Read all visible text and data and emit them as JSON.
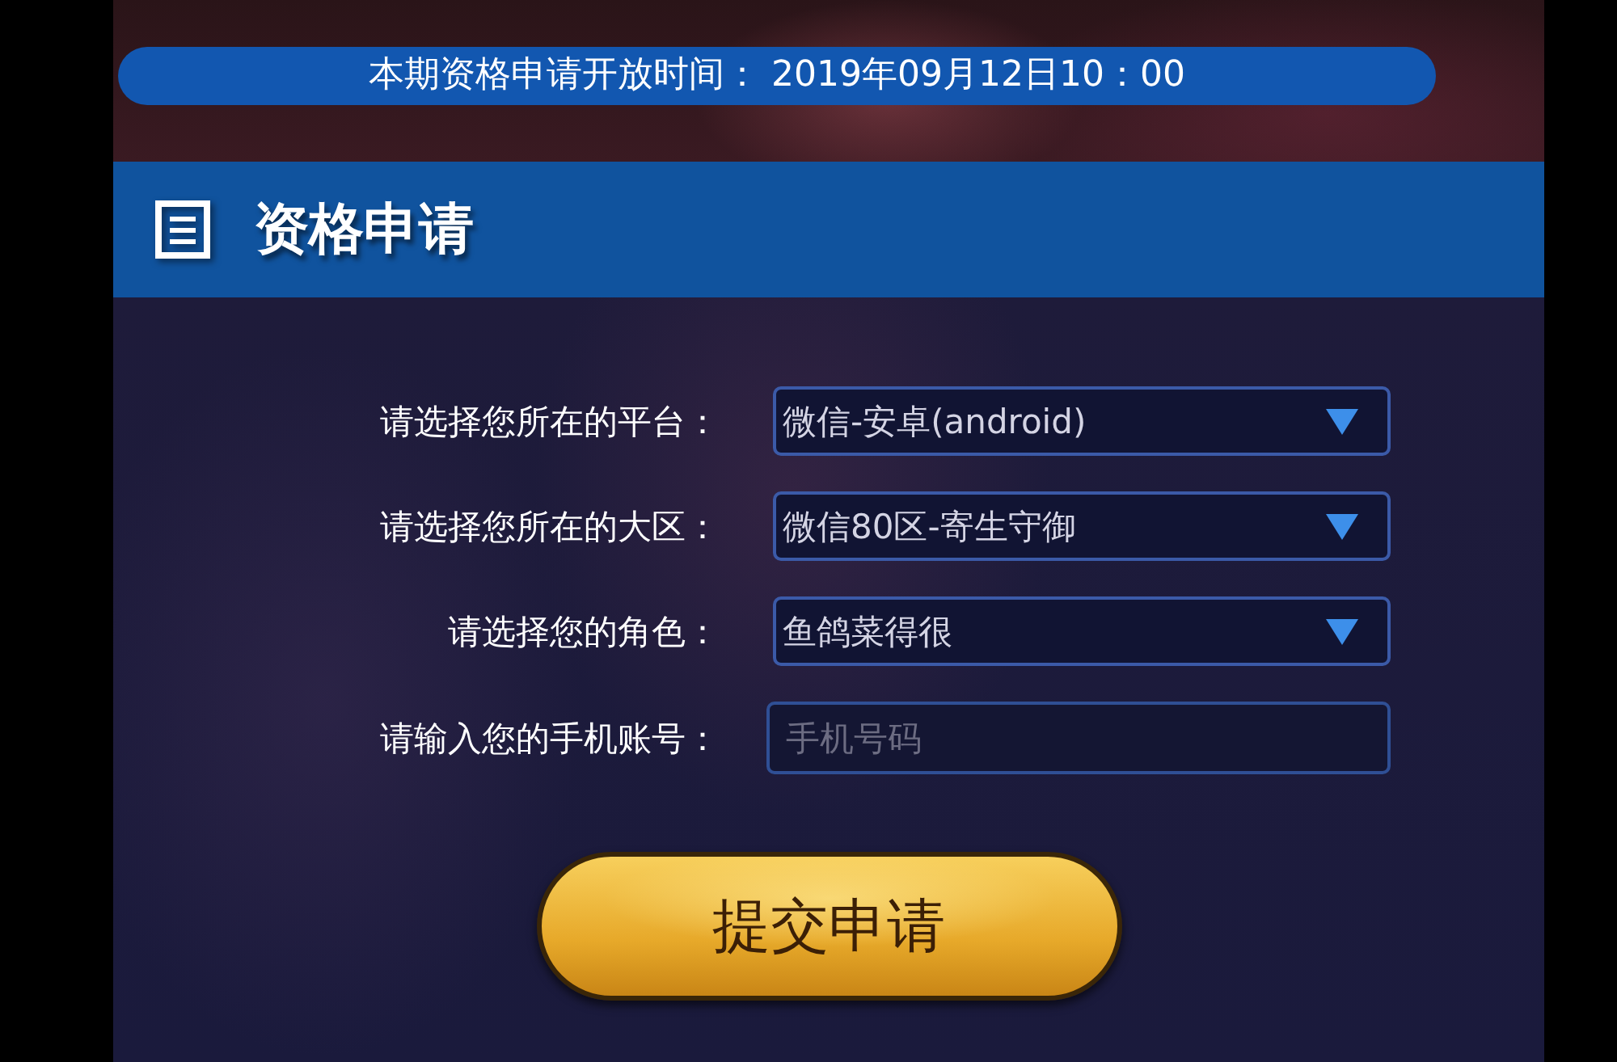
{
  "banner": {
    "text": "本期资格申请开放时间： 2019年09月12日10：00"
  },
  "section": {
    "title": "资格申请"
  },
  "form": {
    "fields": [
      {
        "kind": "select",
        "label": "请选择您所在的平台：",
        "value": "微信-安卓(android)"
      },
      {
        "kind": "select",
        "label": "请选择您所在的大区：",
        "value": "微信80区-寄生守御"
      },
      {
        "kind": "select",
        "label": "请选择您的角色：",
        "value": "鱼鸽菜得很"
      },
      {
        "kind": "input",
        "label": "请输入您的手机账号：",
        "placeholder": "手机号码"
      }
    ]
  },
  "submit": {
    "label": "提交申请"
  }
}
